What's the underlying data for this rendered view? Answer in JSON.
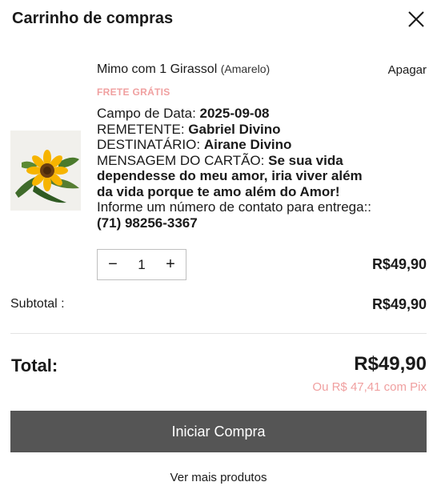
{
  "header": {
    "title": "Carrinho de compras"
  },
  "icons": {
    "close": "close-icon",
    "minus": "minus-icon",
    "plus": "plus-icon"
  },
  "item": {
    "name": "Mimo com 1 Girassol",
    "variant": "(Amarelo)",
    "delete_label": "Apagar",
    "free_shipping": "FRETE GRÁTIS",
    "image_alt": "sunflower bouquet",
    "fields": [
      {
        "label": "Campo de Data: ",
        "value": "2025-09-08"
      },
      {
        "label": "REMETENTE: ",
        "value": "Gabriel Divino"
      },
      {
        "label": "DESTINATÁRIO: ",
        "value": "Airane Divino"
      },
      {
        "label": "MENSAGEM DO CARTÃO: ",
        "value": "Se sua vida dependesse do meu amor, iria viver além da vida porque te amo além do Amor!"
      },
      {
        "label": "Informe um número de contato para entrega:: ",
        "value": "(71) 98256-3367"
      }
    ],
    "quantity": "1",
    "minus_symbol": "−",
    "plus_symbol": "+",
    "price": "R$49,90"
  },
  "summary": {
    "subtotal_label": "Subtotal :",
    "subtotal_value": "R$49,90",
    "total_label": "Total:",
    "total_value": "R$49,90",
    "pix_note": "Ou R$ 47,41 com Pix"
  },
  "actions": {
    "checkout_label": "Iniciar Compra",
    "more_products_label": "Ver mais produtos"
  },
  "colors": {
    "accent_pink": "#f0a0a0",
    "button_bg": "#555555",
    "text": "#1a1a1a"
  }
}
